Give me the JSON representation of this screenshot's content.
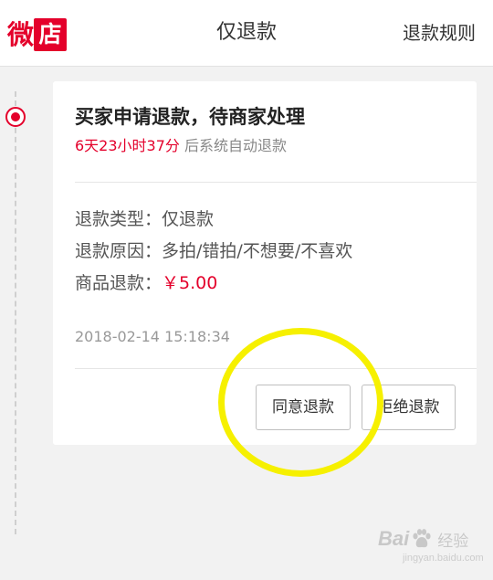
{
  "header": {
    "logo_wei": "微",
    "logo_dian": "店",
    "title": "仅退款",
    "rules_link": "退款规则"
  },
  "card": {
    "title": "买家申请退款，待商家处理",
    "countdown": "6天23小时37分",
    "countdown_suffix": "后系统自动退款",
    "refund_type_label": "退款类型：",
    "refund_type_value": "仅退款",
    "refund_reason_label": "退款原因：",
    "refund_reason_value": "多拍/错拍/不想要/不喜欢",
    "refund_amount_label": "商品退款：",
    "refund_amount_value": "￥5.00",
    "timestamp": "2018-02-14 15:18:34",
    "agree_button": "同意退款",
    "reject_button": "拒绝退款"
  },
  "watermark": {
    "brand_prefix": "Bai",
    "brand_suffix": "经验",
    "url": "jingyan.baidu.com"
  },
  "colors": {
    "accent": "#e4002b",
    "highlight": "#f6f000"
  },
  "icons": {
    "timeline_marker": "radio-dot-icon",
    "watermark_logo": "paw-icon"
  }
}
